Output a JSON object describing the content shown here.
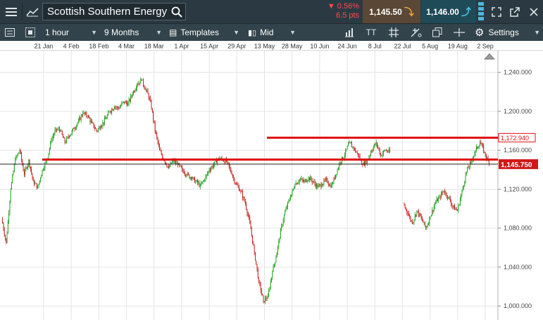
{
  "header": {
    "instrument": "Scottish Southern Energy",
    "change_pct": "▼ 0.56%",
    "change_pts": "6.5 pts",
    "sell_price": "1,145.50",
    "buy_price": "1,146.00"
  },
  "toolbar": {
    "interval": "1 hour",
    "range": "9 Months",
    "templates": "Templates",
    "price_type": "Mid",
    "settings": "Settings",
    "text_tool": "TT"
  },
  "dates": [
    "21 Jan",
    "4 Feb",
    "18 Feb",
    "4 Mar",
    "18 Mar",
    "1 Apr",
    "15 Apr",
    "29 Apr",
    "13 May",
    "28 May",
    "10 Jun",
    "24 Jun",
    "8 Jul",
    "22 Jul",
    "5 Aug",
    "19 Aug",
    "2 Sep"
  ],
  "chart_data": {
    "type": "line",
    "x_labels": [
      "21 Jan",
      "4 Feb",
      "18 Feb",
      "4 Mar",
      "18 Mar",
      "1 Apr",
      "15 Apr",
      "29 Apr",
      "13 May",
      "28 May",
      "10 Jun",
      "24 Jun",
      "8 Jul",
      "22 Jul",
      "5 Aug",
      "19 Aug",
      "2 Sep"
    ],
    "y_ticks": [
      1000,
      1040,
      1080,
      1120,
      1160,
      1200,
      1240
    ],
    "y_tick_labels": [
      "1,000.000",
      "1,040.000",
      "1,080.000",
      "1,120.000",
      "1,160.000",
      "1,200.000",
      "1,240.000"
    ],
    "ylim": [
      990,
      1255
    ],
    "series": [
      {
        "values": [
          1090,
          1065,
          1120,
          1150,
          1160,
          1135,
          1150,
          1128,
          1122,
          1140,
          1150,
          1170,
          1182,
          1180,
          1168,
          1175,
          1182,
          1190,
          1198,
          1195,
          1188,
          1180,
          1185,
          1192,
          1200,
          1205,
          1203,
          1210,
          1208,
          1218,
          1228,
          1232,
          1222,
          1210,
          1180,
          1160,
          1150,
          1142,
          1150,
          1145,
          1140,
          1135,
          1132,
          1128,
          1124,
          1130,
          1140,
          1145,
          1152,
          1150,
          1148,
          1135,
          1125,
          1118,
          1105,
          1085,
          1055,
          1025,
          1005,
          1010,
          1035,
          1055,
          1082,
          1100,
          1112,
          1125,
          1130,
          1128,
          1132,
          1128,
          1122,
          1125,
          1130,
          1122,
          1135,
          1148,
          1155,
          1168,
          1162,
          1155,
          1145,
          1150,
          1160,
          1168,
          1155,
          1160,
          1158,
          null,
          null,
          1105,
          1095,
          1085,
          1098,
          1090,
          1080,
          1092,
          1105,
          1112,
          1118,
          1112,
          1102,
          1098,
          1118,
          1138,
          1148,
          1160,
          1168,
          1158,
          1145.75
        ]
      }
    ],
    "levels": [
      {
        "label": "1,172.940",
        "value": 1172.94,
        "color": "#e01010"
      },
      {
        "label": "",
        "value": 1150.5,
        "color": "#e01010"
      }
    ],
    "current": {
      "label": "1,145.750",
      "value": 1145.75
    }
  }
}
